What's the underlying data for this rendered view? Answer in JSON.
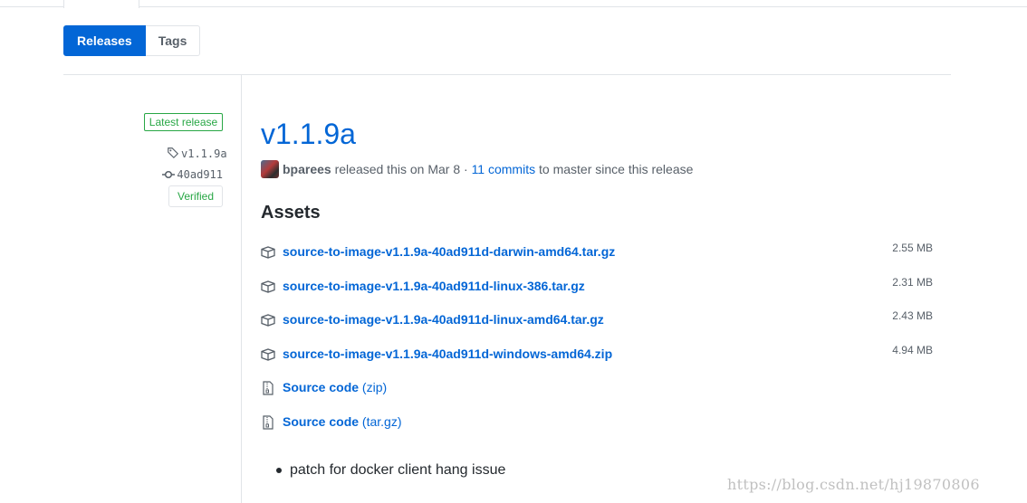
{
  "subnav": {
    "releases_label": "Releases",
    "tags_label": "Tags"
  },
  "meta": {
    "latest_label": "Latest release",
    "tag": "v1.1.9a",
    "commit": "40ad911",
    "verified_label": "Verified"
  },
  "release": {
    "title": "v1.1.9a",
    "author": "bparees",
    "released_text": " released this on Mar 8 · ",
    "commits_link": "11 commits",
    "since_text": " to master since this release"
  },
  "assets": {
    "heading": "Assets",
    "files": [
      {
        "name": "source-to-image-v1.1.9a-40ad911d-darwin-amd64.tar.gz",
        "size": "2.55 MB",
        "icon": "package-icon"
      },
      {
        "name": "source-to-image-v1.1.9a-40ad911d-linux-386.tar.gz",
        "size": "2.31 MB",
        "icon": "package-icon"
      },
      {
        "name": "source-to-image-v1.1.9a-40ad911d-linux-amd64.tar.gz",
        "size": "2.43 MB",
        "icon": "package-icon"
      },
      {
        "name": "source-to-image-v1.1.9a-40ad911d-windows-amd64.zip",
        "size": "4.94 MB",
        "icon": "package-icon"
      }
    ],
    "source": [
      {
        "label": "Source code",
        "format": "(zip)",
        "icon": "file-zip-icon"
      },
      {
        "label": "Source code",
        "format": "(tar.gz)",
        "icon": "file-zip-icon"
      }
    ]
  },
  "notes": {
    "items": [
      "patch for docker client hang issue"
    ]
  },
  "watermark": "https://blog.csdn.net/hj19870806",
  "colors": {
    "accent": "#0366d6",
    "green": "#28a745",
    "muted": "#586069",
    "border": "#e1e4e8"
  }
}
